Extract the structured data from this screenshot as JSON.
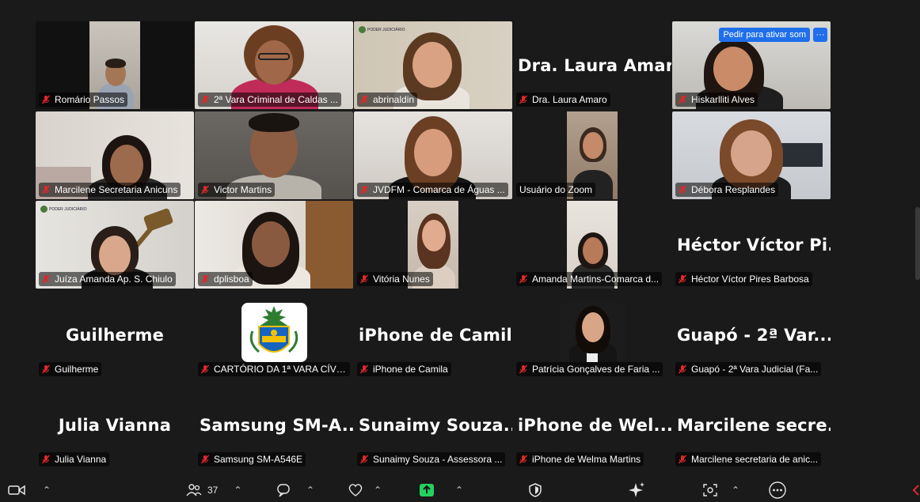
{
  "tiles": [
    {
      "label": "Romário Passos"
    },
    {
      "label": "2ª Vara Criminal de Caldas ..."
    },
    {
      "label": "abrinaldin"
    },
    {
      "label": "Dra. Laura Amaro",
      "bigname": "Dra. Laura Amaro"
    },
    {
      "label": "Hiskarlliti Alves"
    },
    {
      "label": "Marcilene Secretaria Anicuns"
    },
    {
      "label": "Victor Martins"
    },
    {
      "label": "JVDFM - Comarca de Águas ..."
    },
    {
      "label": "Usuário do Zoom"
    },
    {
      "label": "Débora Resplandes"
    },
    {
      "label": "Juíza Amanda Ap. S. Chiulo"
    },
    {
      "label": "dplisboa"
    },
    {
      "label": "Vitória Nunes"
    },
    {
      "label": "Amanda Martins-Comarca d..."
    },
    {
      "label": "Héctor Víctor Pires Barbosa",
      "bigname": "Héctor Víctor Pi..."
    },
    {
      "label": "Guilherme",
      "bigname": "Guilherme"
    },
    {
      "label": "CARTÓRIO DA 1ª VARA CÍVE..."
    },
    {
      "label": "iPhone de Camila",
      "bigname": "iPhone de Camila"
    },
    {
      "label": "Patrícia Gonçalves de Faria ..."
    },
    {
      "label": "Guapó - 2ª  Vara Judicial (Fa...",
      "bigname": "Guapó - 2ª  Var..."
    },
    {
      "label": "Julia Vianna",
      "bigname": "Julia Vianna"
    },
    {
      "label": "Samsung SM-A546E",
      "bigname": "Samsung  SM-A..."
    },
    {
      "label": "Sunaimy Souza - Assessora ...",
      "bigname": "Sunaimy  Souza..."
    },
    {
      "label": "iPhone de Welma Martins",
      "bigname": "iPhone  de  Wel..."
    },
    {
      "label": "Marcilene secretaria de anic...",
      "bigname": "Marcilene  secre..."
    }
  ],
  "ask_unmute": {
    "label": "Pedir para ativar som",
    "more": "···"
  },
  "toolbar": {
    "participants_count": "37"
  },
  "court_logo_text": "PODER JUDICIÁRIO",
  "colors": {
    "mic_muted": "#e02828",
    "accent_blue": "#1f6feb",
    "share_green": "#23d160"
  }
}
